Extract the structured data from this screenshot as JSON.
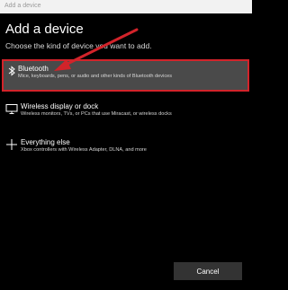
{
  "window": {
    "title": "Add a device"
  },
  "heading": "Add a device",
  "subheading": "Choose the kind of device you want to add.",
  "options": [
    {
      "icon": "bluetooth-icon",
      "title": "Bluetooth",
      "description": "Mice, keyboards, pens, or audio and other kinds of Bluetooth devices",
      "selected": true
    },
    {
      "icon": "monitor-icon",
      "title": "Wireless display or dock",
      "description": "Wireless monitors, TVs, or PCs that use Miracast, or wireless docks",
      "selected": false
    },
    {
      "icon": "plus-icon",
      "title": "Everything else",
      "description": "Xbox controllers with Wireless Adapter, DLNA, and more",
      "selected": false
    }
  ],
  "footer": {
    "cancel_label": "Cancel"
  },
  "colors": {
    "background": "#000000",
    "selected_fill": "#4a4a4a",
    "highlight": "#d2232a",
    "button": "#333333"
  }
}
